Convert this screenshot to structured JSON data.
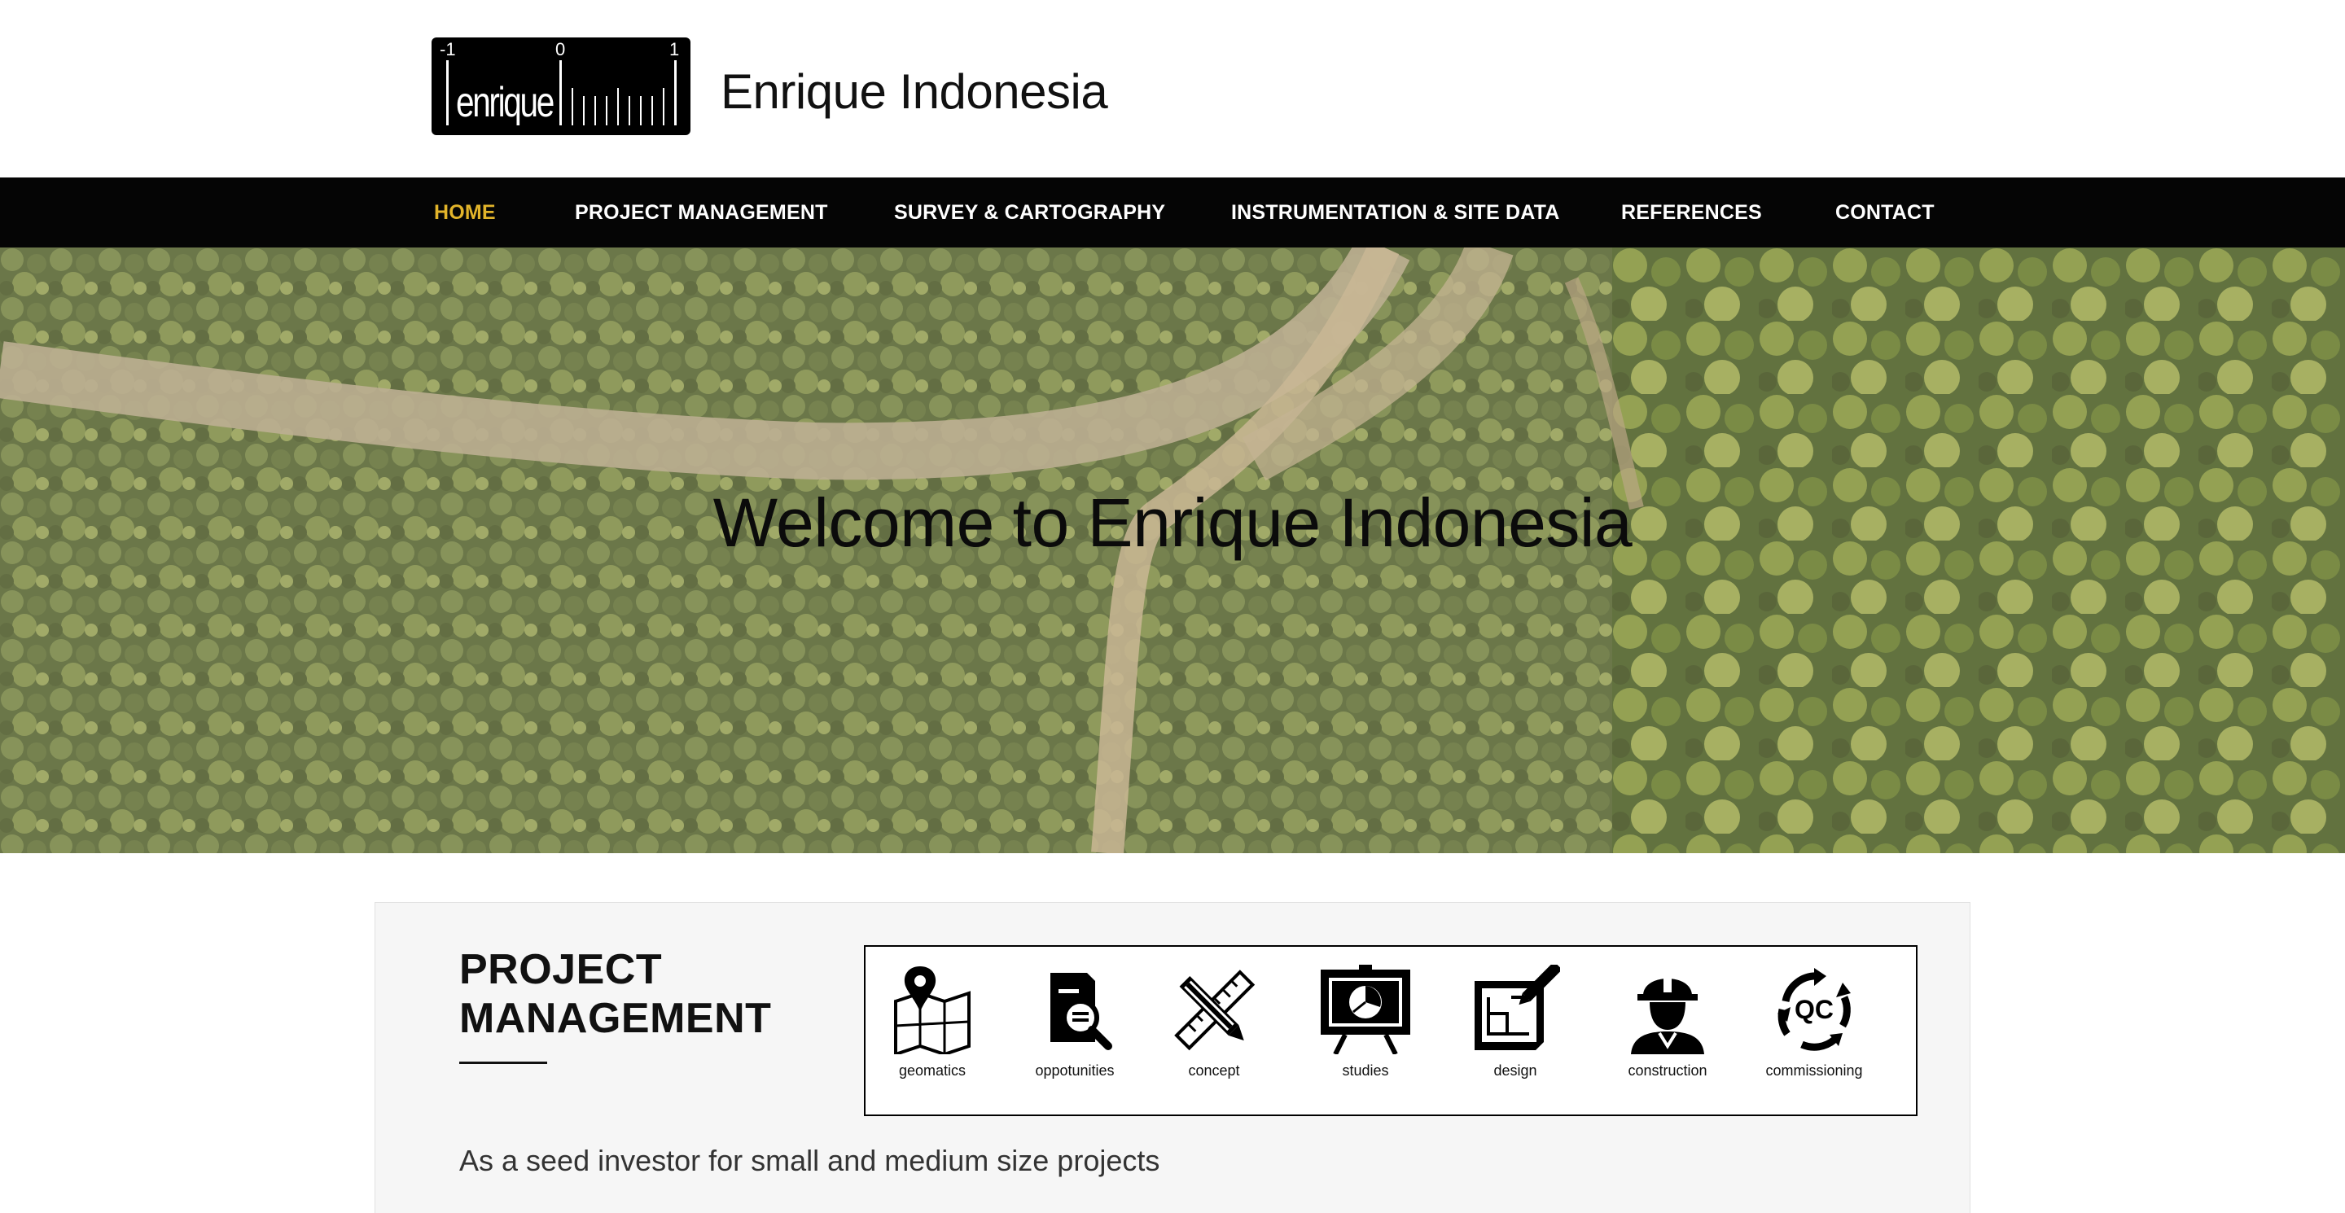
{
  "header": {
    "logo": {
      "word": "enrique",
      "ticks": [
        "-1",
        "0",
        "1"
      ]
    },
    "title": "Enrique Indonesia"
  },
  "nav": {
    "items": [
      {
        "label": "HOME",
        "active": true
      },
      {
        "label": "PROJECT MANAGEMENT",
        "active": false
      },
      {
        "label": "SURVEY & CARTOGRAPHY",
        "active": false
      },
      {
        "label": "INSTRUMENTATION & SITE DATA",
        "active": false
      },
      {
        "label": "REFERENCES",
        "active": false
      },
      {
        "label": "CONTACT",
        "active": false
      }
    ],
    "active_color": "#e2b42a"
  },
  "hero": {
    "title": "Welcome to Enrique Indonesia",
    "image": "aerial-forest-road"
  },
  "project_management": {
    "title_line1": "PROJECT",
    "title_line2": "MANAGEMENT",
    "icons": [
      {
        "label": "geomatics",
        "icon": "map-pin-icon"
      },
      {
        "label": "oppotunities",
        "icon": "document-search-icon"
      },
      {
        "label": "concept",
        "icon": "pencil-ruler-icon"
      },
      {
        "label": "studies",
        "icon": "presentation-board-icon"
      },
      {
        "label": "design",
        "icon": "blueprint-pencil-icon"
      },
      {
        "label": "construction",
        "icon": "hardhat-worker-icon"
      },
      {
        "label": "commissioning",
        "icon": "qc-cycle-icon"
      }
    ],
    "text": "As a seed investor for small and medium size projects"
  }
}
